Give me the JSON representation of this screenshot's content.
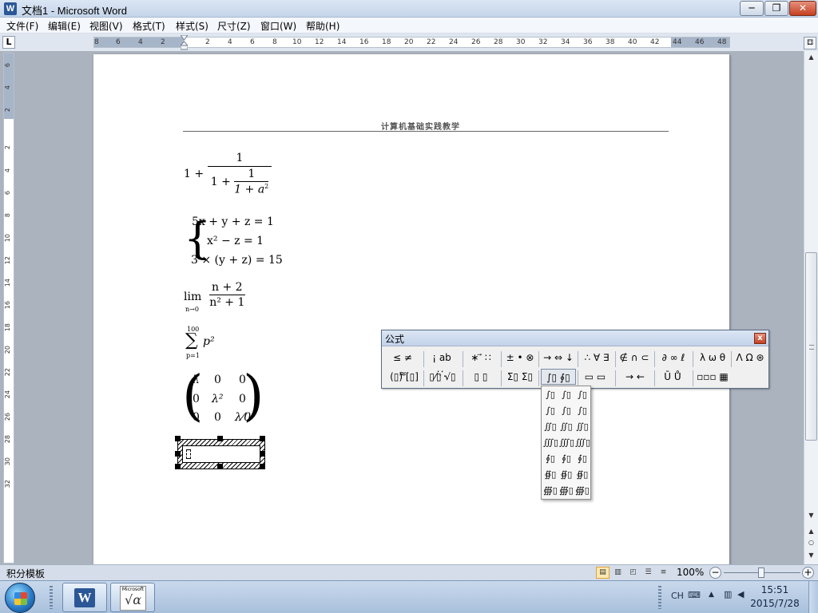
{
  "window": {
    "title": "文档1 - Microsoft Word",
    "app_icon": "W",
    "controls": {
      "minimize": "─",
      "maximize": "❐",
      "close": "✕"
    }
  },
  "menu": [
    "文件(F)",
    "编辑(E)",
    "视图(V)",
    "格式(T)",
    "样式(S)",
    "尺寸(Z)",
    "窗口(W)",
    "帮助(H)"
  ],
  "ruler": {
    "tab_stop_icon": "L",
    "horizontal_ticks": [
      "8",
      "6",
      "4",
      "2",
      "2",
      "4",
      "6",
      "8",
      "10",
      "12",
      "14",
      "16",
      "18",
      "20",
      "22",
      "24",
      "26",
      "28",
      "30",
      "32",
      "34",
      "36",
      "38",
      "40",
      "42",
      "44",
      "46",
      "48"
    ],
    "vertical_ticks": [
      "6",
      "4",
      "2",
      "2",
      "4",
      "6",
      "8",
      "10",
      "12",
      "14",
      "16",
      "18",
      "20",
      "22",
      "24",
      "26",
      "28",
      "30",
      "32"
    ]
  },
  "document": {
    "header": "计算机基础实践教学",
    "eq1": {
      "lead": "1 +",
      "top": "1",
      "inner_lead": "1 +",
      "inner_num": "1",
      "inner_den": "1 + a",
      "exp": "2"
    },
    "eq2": {
      "row1": "5x + y + z = 1",
      "row2": "x² − z = 1",
      "row3": "3 × (y + z) = 15"
    },
    "eq3": {
      "lim": "lim",
      "sub": "n→0",
      "num": "n + 2",
      "den": "n² + 1"
    },
    "eq4": {
      "upper": "100",
      "lower": "p=1",
      "body": "p²"
    },
    "eq5": {
      "row1": [
        "λ",
        "0",
        "0"
      ],
      "row2": [
        "0",
        "λ²",
        "0"
      ],
      "row3": [
        "0",
        "0",
        "λ⁄0"
      ]
    }
  },
  "palette": {
    "title": "公式",
    "close": "x",
    "row1": [
      "≤ ≠ ≈",
      "¡ ab ∵.",
      "∗ ⃗ ∷",
      "± • ⊗",
      "→ ⇔ ↓",
      "∴ ∀ ∃",
      "∉ ∩ ⊂",
      "∂ ∞ ℓ",
      "λ ω θ",
      "Λ Ω ⊛"
    ],
    "row2": [
      "(▯) [▯]",
      "▯⁄▯ √▯",
      "▯ ▯",
      "Σ▯ Σ▯",
      "∫▯ ∮▯",
      "▭ ▭",
      "→ ←",
      "Ū Ů",
      "▫▫▫ ▦"
    ],
    "integral_templates": [
      "∫▯",
      "∫▯",
      "∫▯",
      "∫▯",
      "∫▯",
      "∫▯",
      "∬▯",
      "∬▯",
      "∬▯",
      "∭▯",
      "∭▯",
      "∭▯",
      "∮▯",
      "∮▯",
      "∮▯",
      "∯▯",
      "∯▯",
      "∯▯",
      "∰▯",
      "∰▯",
      "∰▯"
    ]
  },
  "statusbar": {
    "left_text": "积分模板",
    "zoom": "100%",
    "zoom_minus": "−",
    "zoom_plus": "+"
  },
  "taskbar": {
    "word_icon": "W",
    "eq_icon_brand": "Microsoft",
    "eq_icon_symbol": "√α",
    "ime": "CH",
    "time": "15:51",
    "date": "2015/7/28"
  }
}
